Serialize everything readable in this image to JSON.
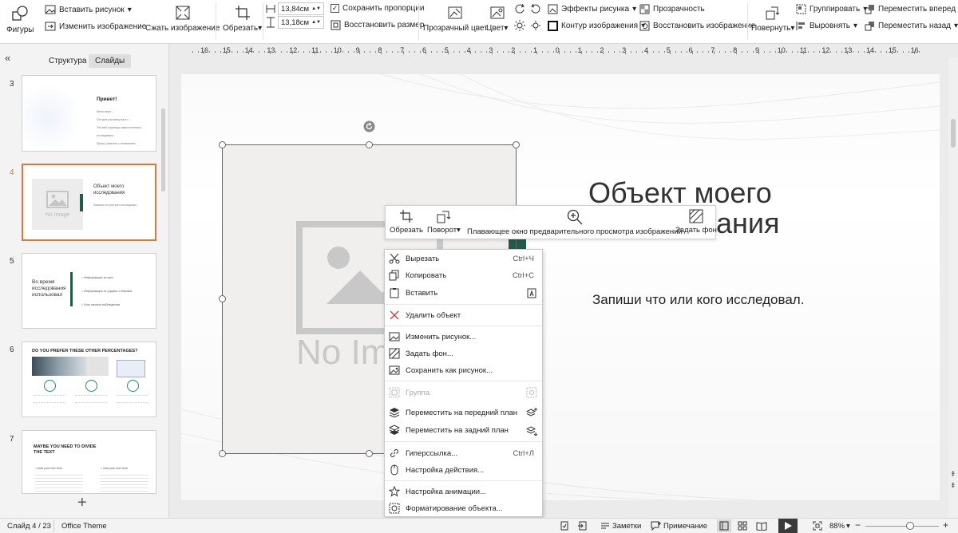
{
  "ribbon": {
    "shapes": "Фигуры",
    "insert_picture": "Вставить рисунок",
    "change_picture": "Изменить изображение",
    "compress": "Сжать изображение",
    "crop": "Обрезать",
    "width": "13,84см",
    "height": "13,18см",
    "keep_ratio": "Сохранить пропорции",
    "restore_size": "Восстановить размер",
    "transparent_color": "Прозрачный цвет",
    "color": "Цвет",
    "picture_effects": "Эффекты рисунка",
    "picture_outline": "Контур изображения",
    "transparency": "Прозрачность",
    "restore_image": "Восстановить изображение",
    "rotate": "Повернуть",
    "group": "Группировать",
    "align": "Выровнять",
    "bring_forward": "Переместить вперед",
    "send_backward": "Переместить назад"
  },
  "left_panel": {
    "tab_outline": "Структура",
    "tab_slides": "Слайды",
    "add_slide": "+",
    "slides": [
      {
        "num": "3",
        "title": "Привет!",
        "lines": [
          "Меня зовут ...",
          "Сегодня расскажу вам о ...",
          "Эта веб-страница самостоятельно исследована",
          "Прошу ответить с понимания!"
        ]
      },
      {
        "num": "4",
        "title": "Объект моего исследования",
        "sub": "Запиши что или кого исследовал.",
        "img_text": "No Image"
      },
      {
        "num": "5",
        "title": "Во время исследования использовал",
        "bullets": [
          "Информация из книг",
          "Информация от родных и близких",
          "Мои личные наблюдения"
        ]
      },
      {
        "num": "6",
        "title": "DO YOU PREFER THESE OTHER PERCENTAGES?"
      },
      {
        "num": "7",
        "title": "MAYBE YOU NEED TO DIVIDE THE TEXT",
        "col1": "Add your text here",
        "col2": "Add your text here"
      }
    ]
  },
  "ruler": [
    "16",
    "15",
    "14",
    "13",
    "12",
    "11",
    "10",
    "9",
    "8",
    "7",
    "6",
    "5",
    "4",
    "3",
    "2",
    "1",
    "0",
    "1",
    "2",
    "3",
    "4",
    "5",
    "6",
    "7",
    "8",
    "9",
    "10",
    "11",
    "12",
    "13",
    "14",
    "15",
    "16"
  ],
  "slide": {
    "title_line1": "Объект моего",
    "title_line2": "ания",
    "subtitle": "Запиши что или кого исследовал.",
    "no_image": "No Im"
  },
  "mini_toolbar": {
    "crop": "Обрезать",
    "rotate": "Поворот",
    "preview": "Плавающее окно предварительного просмотра изображений",
    "set_bg": "Задать фон"
  },
  "context_menu": {
    "cut": "Вырезать",
    "cut_sc": "Ctrl+Ч",
    "copy": "Копировать",
    "copy_sc": "Ctrl+С",
    "paste": "Вставить",
    "delete": "Удалить объект",
    "change_picture": "Изменить рисунок...",
    "set_bg": "Задать фон...",
    "save_as": "Сохранить как рисунок...",
    "group": "Группа",
    "bring_front": "Переместить на передний план",
    "send_back": "Переместить на задний план",
    "hyperlink": "Гиперссылка...",
    "hyperlink_sc": "Ctrl+Л",
    "action": "Настройка действия...",
    "animation": "Настройка анимации...",
    "format": "Форматирование объекта..."
  },
  "status": {
    "slide_info": "Слайд 4 / 23",
    "theme": "Office Theme",
    "notes": "Заметки",
    "comment": "Примечание",
    "zoom": "88%"
  },
  "colors": {
    "accent": "#d97a3c",
    "dark_green": "#1f5c4a",
    "placeholder_gray": "#c8c8c8"
  }
}
